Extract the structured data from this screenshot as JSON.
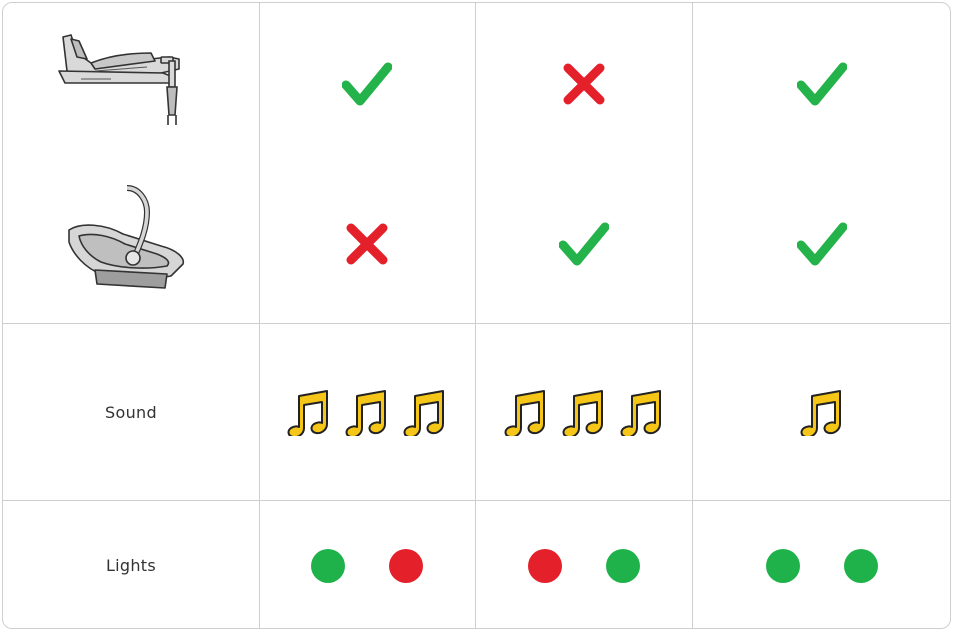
{
  "table": {
    "rows": [
      {
        "kind": "product",
        "icon": "isofix-base-icon",
        "values": [
          "check",
          "cross",
          "check"
        ]
      },
      {
        "kind": "product",
        "icon": "infant-car-seat-icon",
        "values": [
          "cross",
          "check",
          "check"
        ]
      },
      {
        "kind": "sound",
        "label": "Sound",
        "values": [
          3,
          3,
          1
        ]
      },
      {
        "kind": "lights",
        "label": "Lights",
        "values": [
          [
            "green",
            "red"
          ],
          [
            "red",
            "green"
          ],
          [
            "green",
            "green"
          ]
        ]
      }
    ]
  },
  "colors": {
    "check": "#23b34a",
    "cross": "#e4202a",
    "green": "#1fb24a",
    "red": "#e4202a",
    "note_fill": "#f5c518",
    "note_stroke": "#222222",
    "border": "#cfcfcf"
  }
}
